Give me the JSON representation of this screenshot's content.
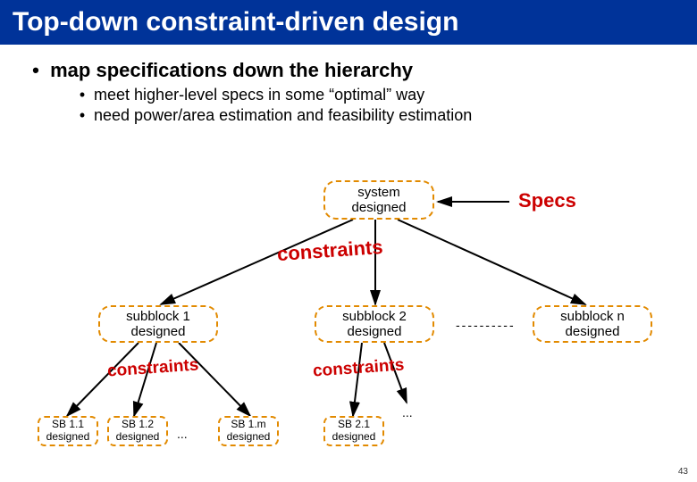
{
  "title": "Top-down constraint-driven design",
  "bullet1": "map specifications down the hierarchy",
  "bullet2a": "meet higher-level specs in some “optimal” way",
  "bullet2b": "need power/area estimation and feasibility estimation",
  "specs_label": "Specs",
  "constraints_label": "constraints",
  "nodes": {
    "system": {
      "l1": "system",
      "l2": "designed"
    },
    "sb1": {
      "l1": "subblock 1",
      "l2": "designed"
    },
    "sb2": {
      "l1": "subblock 2",
      "l2": "designed"
    },
    "sbn": {
      "l1": "subblock n",
      "l2": "designed"
    },
    "sb11": {
      "l1": "SB 1.1",
      "l2": "designed"
    },
    "sb12": {
      "l1": "SB 1.2",
      "l2": "designed"
    },
    "sb1m": {
      "l1": "SB 1.m",
      "l2": "designed"
    },
    "sb21": {
      "l1": "SB 2.1",
      "l2": "designed"
    }
  },
  "ellipsis": "...",
  "dashrow": "----------",
  "page": "43"
}
